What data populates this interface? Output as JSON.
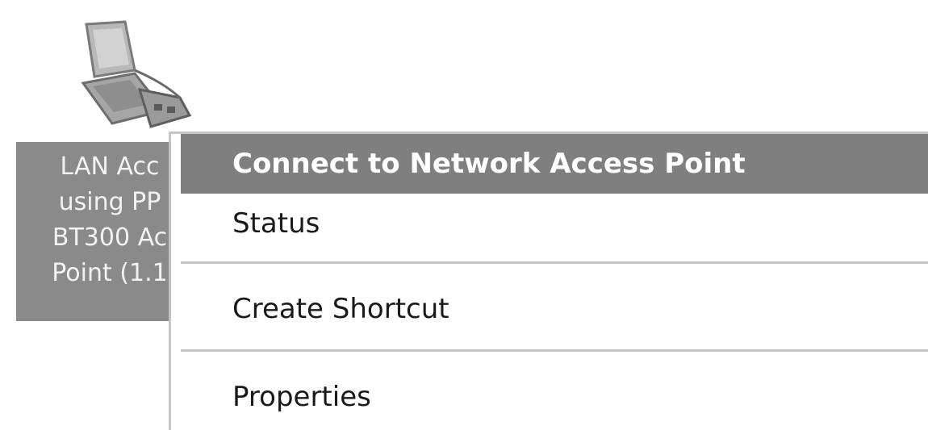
{
  "desktop_icon": {
    "icon": "network-computer-icon",
    "label_lines": [
      "LAN Acc",
      "using PP",
      "BT300 Ac",
      "Point (1.1"
    ]
  },
  "context_menu": {
    "items": [
      {
        "label": "Connect to Network Access Point",
        "default": true
      },
      {
        "label": "Status"
      },
      {
        "label": "Create Shortcut"
      },
      {
        "label": "Properties"
      }
    ]
  },
  "colors": {
    "highlight": "#7f7f7f",
    "label_background": "#8a8a8a",
    "separator": "#c4c4c4"
  }
}
